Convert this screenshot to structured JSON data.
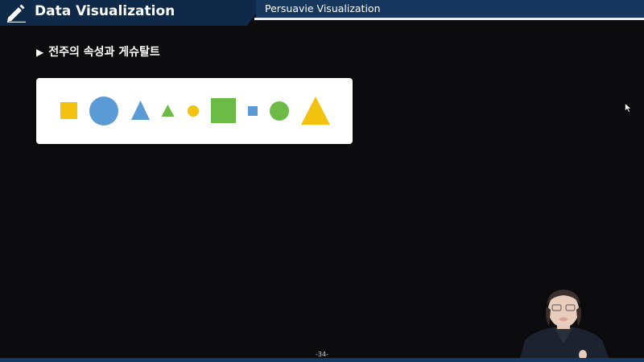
{
  "header": {
    "title": "Data Visualization",
    "subtitle": "Persuavie Visualization",
    "icon": "pencil-icon"
  },
  "section": {
    "bullet": "▶",
    "heading": "전주의 속성과 게슈탈트"
  },
  "shapes_card": {
    "shapes": [
      {
        "type": "square",
        "size": "small",
        "color": "#f3c20f"
      },
      {
        "type": "circle",
        "size": "large",
        "color": "#5b9bd5"
      },
      {
        "type": "triangle",
        "size": "medium",
        "color": "#5b9bd5"
      },
      {
        "type": "triangle",
        "size": "small",
        "color": "#6cbb46"
      },
      {
        "type": "circle",
        "size": "small",
        "color": "#f3c20f"
      },
      {
        "type": "square",
        "size": "large",
        "color": "#6cbb46"
      },
      {
        "type": "square",
        "size": "small",
        "color": "#5b9bd5"
      },
      {
        "type": "circle",
        "size": "medium",
        "color": "#6cbb46"
      },
      {
        "type": "triangle",
        "size": "large",
        "color": "#f3c20f"
      }
    ]
  },
  "footer": {
    "page_number": "-34-"
  }
}
